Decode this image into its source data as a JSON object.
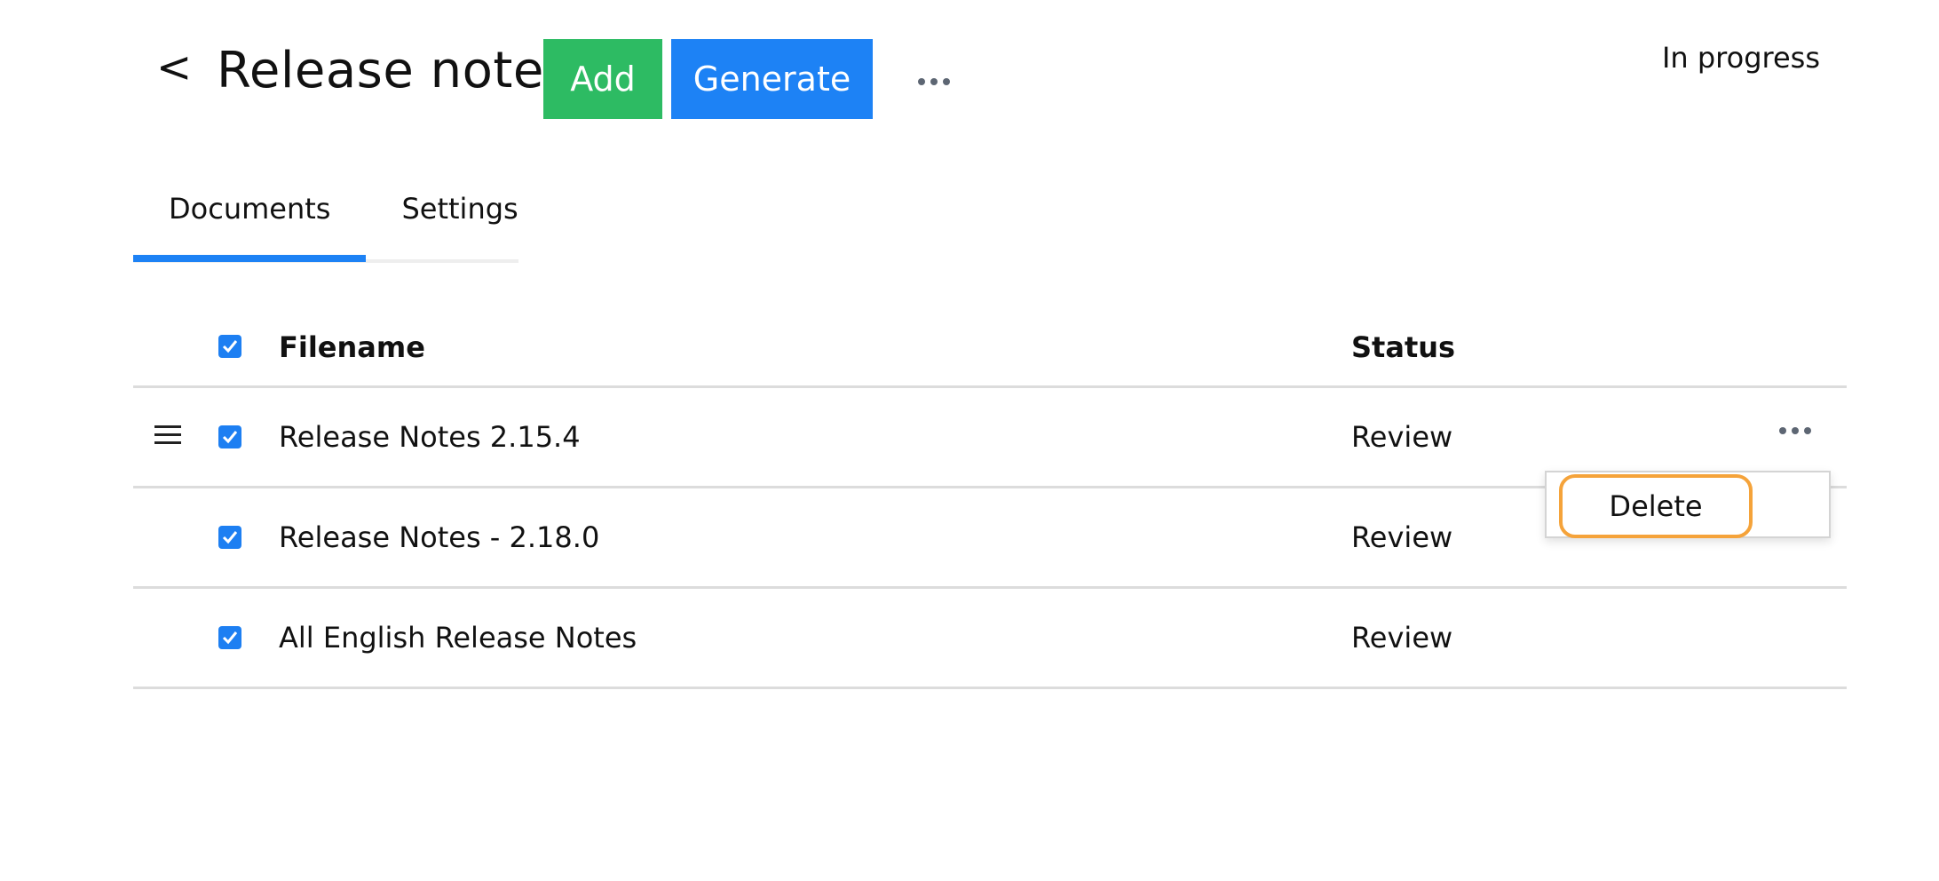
{
  "header": {
    "back_label": "<",
    "title": "Release notes",
    "add_label": "Add",
    "generate_label": "Generate",
    "status": "In progress"
  },
  "tabs": [
    {
      "label": "Documents",
      "active": true
    },
    {
      "label": "Settings",
      "active": false
    }
  ],
  "table": {
    "columns": {
      "filename": "Filename",
      "status": "Status"
    },
    "all_selected": true,
    "rows": [
      {
        "filename": "Release Notes 2.15.4",
        "status": "Review",
        "selected": true
      },
      {
        "filename": "Release Notes - 2.18.0",
        "status": "Review",
        "selected": true
      },
      {
        "filename": "All English Release Notes",
        "status": "Review",
        "selected": true
      }
    ]
  },
  "context_menu": {
    "items": [
      {
        "label": "Delete"
      }
    ]
  },
  "colors": {
    "add_button": "#2dbb63",
    "generate_button": "#1d82f5",
    "active_tab_indicator": "#1d82f5",
    "checkbox": "#1d7ff2",
    "highlight_outline": "#f5a33a"
  }
}
